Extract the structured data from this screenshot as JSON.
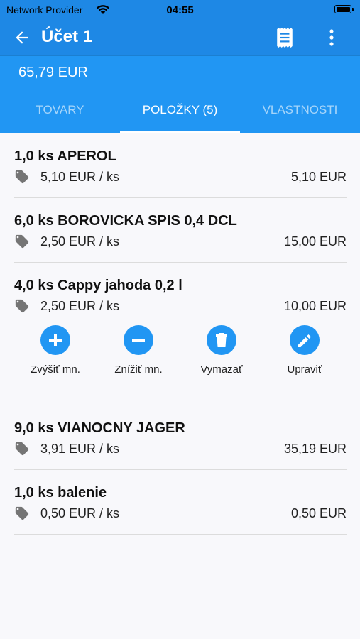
{
  "status": {
    "carrier": "Network Provider",
    "time": "04:55"
  },
  "header": {
    "title": "Účet 1",
    "amount": "65,79 EUR"
  },
  "tabs": [
    {
      "label": "TOVARY"
    },
    {
      "label": "POLOŽKY (5)"
    },
    {
      "label": "VLASTNOSTI"
    }
  ],
  "items": [
    {
      "name": "1,0 ks APEROL",
      "unit_price": "5,10 EUR / ks",
      "total": "5,10 EUR"
    },
    {
      "name": "6,0 ks BOROVICKA SPIS 0,4 DCL",
      "unit_price": "2,50 EUR / ks",
      "total": "15,00 EUR"
    },
    {
      "name": "4,0 ks Cappy jahoda 0,2 l",
      "unit_price": "2,50 EUR / ks",
      "total": "10,00 EUR"
    },
    {
      "name": "9,0 ks VIANOCNY JAGER",
      "unit_price": "3,91 EUR / ks",
      "total": "35,19 EUR"
    },
    {
      "name": "1,0 ks balenie",
      "unit_price": "0,50 EUR / ks",
      "total": "0,50 EUR"
    }
  ],
  "actions": {
    "increase": "Zvýšiť mn.",
    "decrease": "Znížiť mn.",
    "delete": "Vymazať",
    "edit": "Upraviť"
  },
  "colors": {
    "primary": "#1e88e5",
    "tab_bar": "#2196f3",
    "background": "#f8f8fb"
  },
  "icons": [
    "wifi-icon",
    "battery-icon",
    "back-arrow-icon",
    "receipt-icon",
    "more-vert-icon",
    "price-tag-icon",
    "plus-icon",
    "minus-icon",
    "trash-icon",
    "pencil-icon"
  ]
}
